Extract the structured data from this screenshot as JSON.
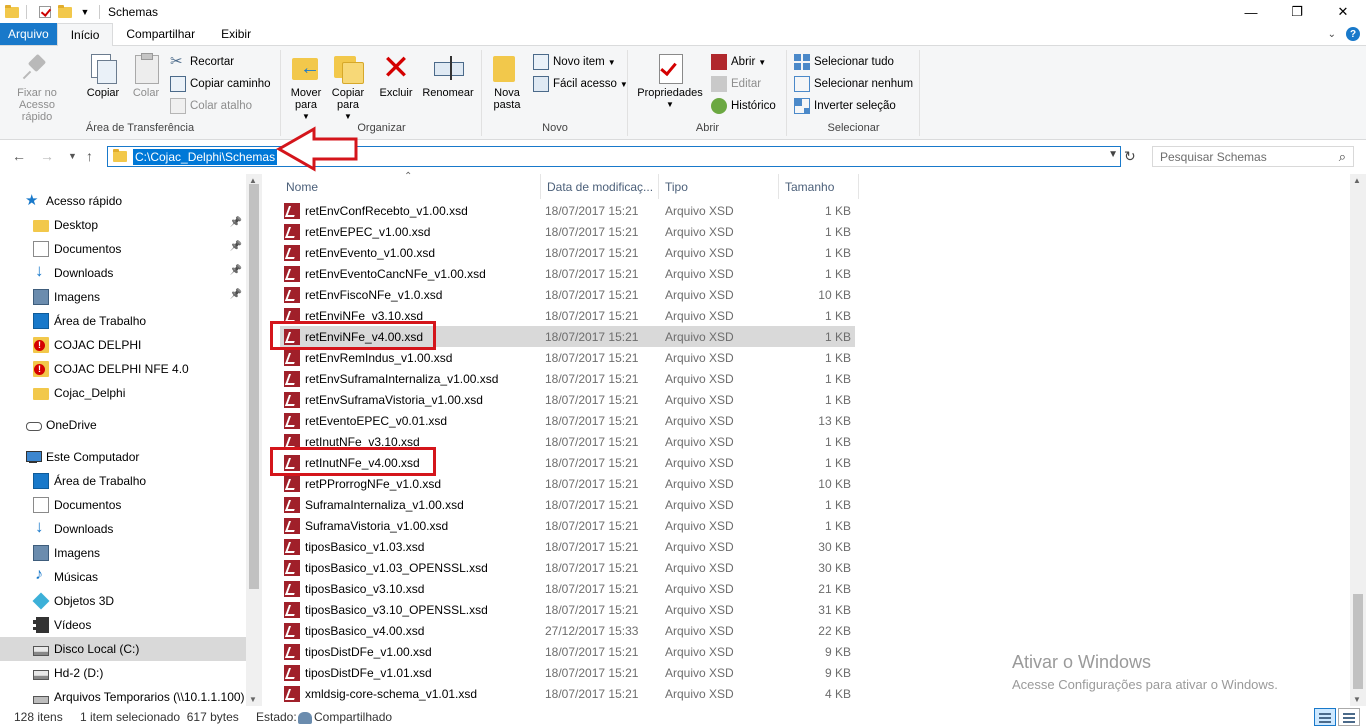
{
  "window": {
    "title": "Schemas",
    "minimize": "—",
    "maximize": "❐",
    "close": "✕"
  },
  "tabs": [
    {
      "label": "Arquivo"
    },
    {
      "label": "Início"
    },
    {
      "label": "Compartilhar"
    },
    {
      "label": "Exibir"
    }
  ],
  "ribbon": {
    "clipboard": {
      "label": "Área de Transferência",
      "pin": "Fixar no Acesso rápido",
      "copy": "Copiar",
      "paste": "Colar",
      "cut": "Recortar",
      "copy_path": "Copiar caminho",
      "paste_shortcut": "Colar atalho"
    },
    "organize": {
      "label": "Organizar",
      "move": "Mover para",
      "copyto": "Copiar para",
      "delete": "Excluir",
      "rename": "Renomear"
    },
    "new": {
      "label": "Novo",
      "new_folder": "Nova pasta",
      "new_item": "Novo item",
      "easy_access": "Fácil acesso"
    },
    "open": {
      "label": "Abrir",
      "properties": "Propriedades",
      "open": "Abrir",
      "edit": "Editar",
      "history": "Histórico"
    },
    "select": {
      "label": "Selecionar",
      "select_all": "Selecionar tudo",
      "select_none": "Selecionar nenhum",
      "invert": "Inverter seleção"
    }
  },
  "address": {
    "path": "C:\\Cojac_Delphi\\Schemas",
    "search_placeholder": "Pesquisar Schemas"
  },
  "nav": {
    "items": [
      {
        "label": "Acesso rápido",
        "icon": "star",
        "indent": 0,
        "pinned": false
      },
      {
        "label": "Desktop",
        "icon": "folder",
        "indent": 1,
        "pinned": true
      },
      {
        "label": "Documentos",
        "icon": "docs",
        "indent": 1,
        "pinned": true
      },
      {
        "label": "Downloads",
        "icon": "down",
        "indent": 1,
        "pinned": true
      },
      {
        "label": "Imagens",
        "icon": "img",
        "indent": 1,
        "pinned": true
      },
      {
        "label": "Área de Trabalho",
        "icon": "desk",
        "indent": 1,
        "pinned": false
      },
      {
        "label": "COJAC DELPHI",
        "icon": "warn",
        "indent": 1,
        "pinned": false
      },
      {
        "label": "COJAC DELPHI NFE 4.0",
        "icon": "warn",
        "indent": 1,
        "pinned": false
      },
      {
        "label": "Cojac_Delphi",
        "icon": "folder",
        "indent": 1,
        "pinned": false
      },
      {
        "label": "OneDrive",
        "icon": "cloud",
        "indent": 0,
        "pinned": false
      },
      {
        "label": "Este Computador",
        "icon": "pc",
        "indent": 0,
        "pinned": false
      },
      {
        "label": "Área de Trabalho",
        "icon": "desk",
        "indent": 1,
        "pinned": false
      },
      {
        "label": "Documentos",
        "icon": "docs",
        "indent": 1,
        "pinned": false
      },
      {
        "label": "Downloads",
        "icon": "down",
        "indent": 1,
        "pinned": false
      },
      {
        "label": "Imagens",
        "icon": "img",
        "indent": 1,
        "pinned": false
      },
      {
        "label": "Músicas",
        "icon": "music",
        "indent": 1,
        "pinned": false
      },
      {
        "label": "Objetos 3D",
        "icon": "3d",
        "indent": 1,
        "pinned": false
      },
      {
        "label": "Vídeos",
        "icon": "video",
        "indent": 1,
        "pinned": false
      },
      {
        "label": "Disco Local (C:)",
        "icon": "drive",
        "indent": 1,
        "pinned": false,
        "selected": true
      },
      {
        "label": "Hd-2 (D:)",
        "icon": "drive",
        "indent": 1,
        "pinned": false
      },
      {
        "label": "Arquivos Temporarios (\\\\10.1.1.100)",
        "icon": "netdrive",
        "indent": 1,
        "pinned": false
      }
    ]
  },
  "columns": {
    "name": "Nome",
    "date": "Data de modificaç...",
    "type": "Tipo",
    "size": "Tamanho"
  },
  "files": [
    {
      "name": "retEnvConfRecebto_v1.00.xsd",
      "date": "18/07/2017 15:21",
      "type": "Arquivo XSD",
      "size": "1 KB"
    },
    {
      "name": "retEnvEPEC_v1.00.xsd",
      "date": "18/07/2017 15:21",
      "type": "Arquivo XSD",
      "size": "1 KB"
    },
    {
      "name": "retEnvEvento_v1.00.xsd",
      "date": "18/07/2017 15:21",
      "type": "Arquivo XSD",
      "size": "1 KB"
    },
    {
      "name": "retEnvEventoCancNFe_v1.00.xsd",
      "date": "18/07/2017 15:21",
      "type": "Arquivo XSD",
      "size": "1 KB"
    },
    {
      "name": "retEnvFiscoNFe_v1.0.xsd",
      "date": "18/07/2017 15:21",
      "type": "Arquivo XSD",
      "size": "10 KB"
    },
    {
      "name": "retEnviNFe_v3.10.xsd",
      "date": "18/07/2017 15:21",
      "type": "Arquivo XSD",
      "size": "1 KB"
    },
    {
      "name": "retEnviNFe_v4.00.xsd",
      "date": "18/07/2017 15:21",
      "type": "Arquivo XSD",
      "size": "1 KB",
      "selected": true,
      "highlight": true
    },
    {
      "name": "retEnvRemIndus_v1.00.xsd",
      "date": "18/07/2017 15:21",
      "type": "Arquivo XSD",
      "size": "1 KB"
    },
    {
      "name": "retEnvSuframaInternaliza_v1.00.xsd",
      "date": "18/07/2017 15:21",
      "type": "Arquivo XSD",
      "size": "1 KB"
    },
    {
      "name": "retEnvSuframaVistoria_v1.00.xsd",
      "date": "18/07/2017 15:21",
      "type": "Arquivo XSD",
      "size": "1 KB"
    },
    {
      "name": "retEventoEPEC_v0.01.xsd",
      "date": "18/07/2017 15:21",
      "type": "Arquivo XSD",
      "size": "13 KB"
    },
    {
      "name": "retInutNFe_v3.10.xsd",
      "date": "18/07/2017 15:21",
      "type": "Arquivo XSD",
      "size": "1 KB"
    },
    {
      "name": "retInutNFe_v4.00.xsd",
      "date": "18/07/2017 15:21",
      "type": "Arquivo XSD",
      "size": "1 KB",
      "highlight": true
    },
    {
      "name": "retPProrrogNFe_v1.0.xsd",
      "date": "18/07/2017 15:21",
      "type": "Arquivo XSD",
      "size": "10 KB"
    },
    {
      "name": "SuframaInternaliza_v1.00.xsd",
      "date": "18/07/2017 15:21",
      "type": "Arquivo XSD",
      "size": "1 KB"
    },
    {
      "name": "SuframaVistoria_v1.00.xsd",
      "date": "18/07/2017 15:21",
      "type": "Arquivo XSD",
      "size": "1 KB"
    },
    {
      "name": "tiposBasico_v1.03.xsd",
      "date": "18/07/2017 15:21",
      "type": "Arquivo XSD",
      "size": "30 KB"
    },
    {
      "name": "tiposBasico_v1.03_OPENSSL.xsd",
      "date": "18/07/2017 15:21",
      "type": "Arquivo XSD",
      "size": "30 KB"
    },
    {
      "name": "tiposBasico_v3.10.xsd",
      "date": "18/07/2017 15:21",
      "type": "Arquivo XSD",
      "size": "21 KB"
    },
    {
      "name": "tiposBasico_v3.10_OPENSSL.xsd",
      "date": "18/07/2017 15:21",
      "type": "Arquivo XSD",
      "size": "31 KB"
    },
    {
      "name": "tiposBasico_v4.00.xsd",
      "date": "27/12/2017 15:33",
      "type": "Arquivo XSD",
      "size": "22 KB"
    },
    {
      "name": "tiposDistDFe_v1.00.xsd",
      "date": "18/07/2017 15:21",
      "type": "Arquivo XSD",
      "size": "9 KB"
    },
    {
      "name": "tiposDistDFe_v1.01.xsd",
      "date": "18/07/2017 15:21",
      "type": "Arquivo XSD",
      "size": "9 KB"
    },
    {
      "name": "xmldsig-core-schema_v1.01.xsd",
      "date": "18/07/2017 15:21",
      "type": "Arquivo XSD",
      "size": "4 KB"
    }
  ],
  "watermark": {
    "title": "Ativar o Windows",
    "subtitle": "Acesse Configurações para ativar o Windows."
  },
  "status": {
    "count": "128 itens",
    "selection": "1 item selecionado  617 bytes",
    "state_label": "Estado:",
    "state_value": "Compartilhado"
  },
  "colors": {
    "accent": "#1979ca",
    "annotation_red": "#d4151b",
    "selection": "#d9d9d9"
  }
}
